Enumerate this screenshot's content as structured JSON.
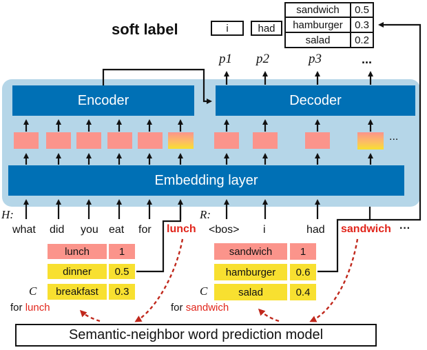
{
  "soft_label": {
    "title": "soft label",
    "tokens": [
      "i",
      "had"
    ],
    "distribution": [
      {
        "word": "sandwich",
        "prob": "0.5"
      },
      {
        "word": "hamburger",
        "prob": "0.3"
      },
      {
        "word": "salad",
        "prob": "0.2"
      }
    ]
  },
  "outputs": [
    "p1",
    "p2",
    "p3",
    "..."
  ],
  "encoder_label": "Encoder",
  "decoder_label": "Decoder",
  "embedding_label": "Embedding layer",
  "decoder_ellipsis": "...",
  "history": {
    "prefix": "H:",
    "words": [
      "what",
      "did",
      "you",
      "eat",
      "for"
    ],
    "highlight": "lunch"
  },
  "response": {
    "prefix": "R:",
    "words": [
      "<bos>",
      "i",
      "had"
    ],
    "highlight": "sandwich",
    "ellipsis": "···"
  },
  "candidates_lunch": {
    "symbol": "C",
    "caption_prefix": "for",
    "caption_word": "lunch",
    "rows": [
      {
        "word": "lunch",
        "score": "1",
        "type": "target"
      },
      {
        "word": "dinner",
        "score": "0.5",
        "type": "neighbor"
      },
      {
        "word": "breakfast",
        "score": "0.3",
        "type": "neighbor"
      }
    ]
  },
  "candidates_sandwich": {
    "symbol": "C",
    "caption_prefix": "for",
    "caption_word": "sandwich",
    "rows": [
      {
        "word": "sandwich",
        "score": "1",
        "type": "target"
      },
      {
        "word": "hamburger",
        "score": "0.6",
        "type": "neighbor"
      },
      {
        "word": "salad",
        "score": "0.4",
        "type": "neighbor"
      }
    ]
  },
  "model_label": "Semantic-neighbor word prediction model",
  "colors": {
    "panel": "#b5d6e8",
    "block": "#0070b5",
    "target_cell": "#fb948b",
    "neighbor_cell": "#f8e030",
    "highlight_text": "#e1251b",
    "dashed_arrow": "#c0281c"
  }
}
